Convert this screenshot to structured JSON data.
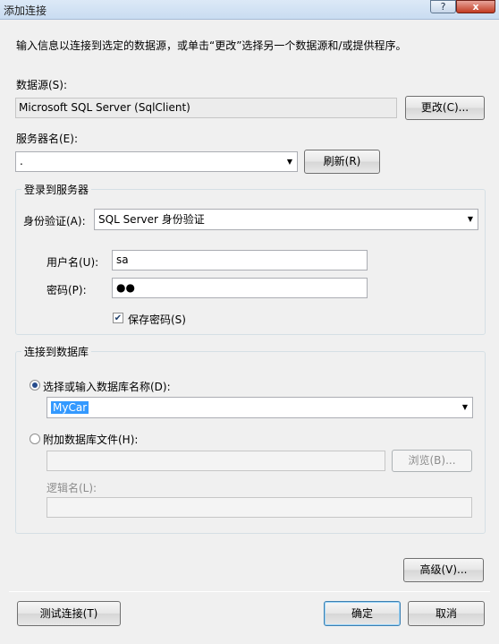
{
  "window": {
    "title": "添加连接",
    "help_button": "?",
    "close_button": "x"
  },
  "description": "输入信息以连接到选定的数据源，或单击“更改”选择另一个数据源和/或提供程序。",
  "datasource": {
    "label": "数据源(S):",
    "value": "Microsoft SQL Server (SqlClient)",
    "change_button": "更改(C)..."
  },
  "server": {
    "label": "服务器名(E):",
    "value": ".",
    "refresh_button": "刷新(R)"
  },
  "login": {
    "group_title": "登录到服务器",
    "auth_label": "身份验证(A):",
    "auth_value": "SQL Server 身份验证",
    "username_label": "用户名(U):",
    "username_value": "sa",
    "password_label": "密码(P):",
    "password_value": "●●",
    "save_password_label": "保存密码(S)",
    "save_password_checked": true
  },
  "database": {
    "group_title": "连接到数据库",
    "select_db_radio_label": "选择或输入数据库名称(D):",
    "db_name_value": "MyCar",
    "attach_file_radio_label": "附加数据库文件(H):",
    "attach_file_value": "",
    "browse_button": "浏览(B)...",
    "logical_name_label": "逻辑名(L):",
    "logical_name_value": ""
  },
  "advanced_button": "高级(V)...",
  "footer": {
    "test_button": "测试连接(T)",
    "ok_button": "确定",
    "cancel_button": "取消"
  }
}
